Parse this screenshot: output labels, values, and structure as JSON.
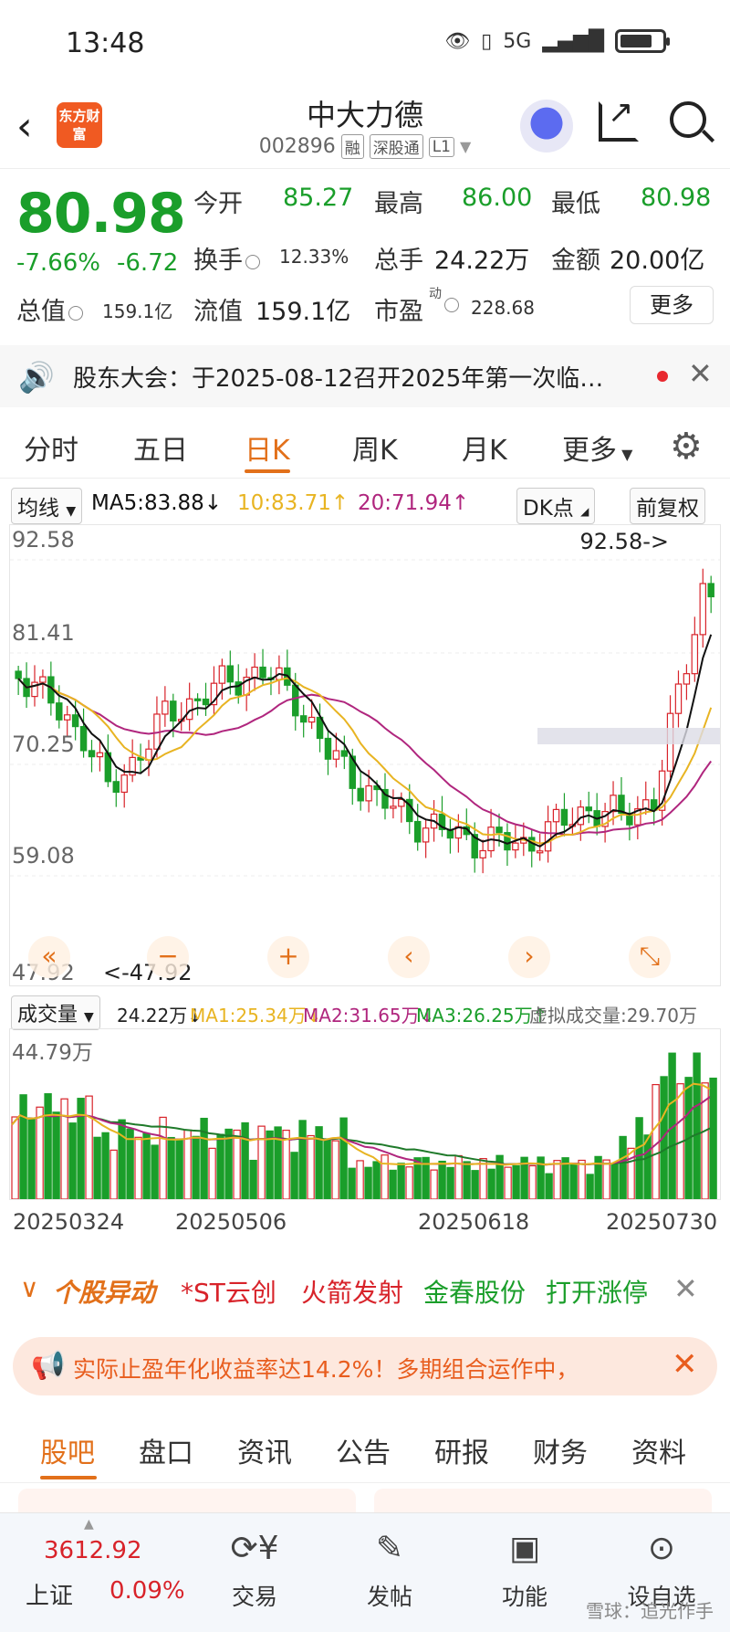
{
  "status_bar": {
    "time": "13:48",
    "network": "5G"
  },
  "header": {
    "title": "中大力德",
    "code": "002896",
    "tags": [
      "融",
      "深股通",
      "L1"
    ],
    "logo_text": "东方财富"
  },
  "quote": {
    "price": "80.98",
    "change_pct": "-7.66%",
    "change_abs": "-6.72",
    "open_label": "今开",
    "open": "85.27",
    "high_label": "最高",
    "high": "86.00",
    "low_label": "最低",
    "low": "80.98",
    "turnover_label": "换手",
    "turnover": "12.33%",
    "volume_label": "总手",
    "volume": "24.22万",
    "amount_label": "金额",
    "amount": "20.00亿",
    "mktcap_label": "总值",
    "mktcap": "159.1亿",
    "float_label": "流值",
    "float": "159.1亿",
    "pe_label": "市盈",
    "pe_sup": "动",
    "pe": "228.68",
    "more_label": "更多"
  },
  "notice": {
    "text": "股东大会：于2025-08-12召开2025年第一次临…"
  },
  "chart_tabs": [
    "分时",
    "五日",
    "日K",
    "周K",
    "月K",
    "更多"
  ],
  "ma_bar": {
    "selector": "均线",
    "ma5": "MA5:83.88",
    "ma10": "10:83.71",
    "ma20": "20:71.94",
    "dk": "DK点",
    "adjust": "前复权"
  },
  "kline": {
    "y_labels": [
      "92.58",
      "81.41",
      "70.25",
      "59.08",
      "47.92"
    ],
    "high_annotation": "92.58->",
    "low_annotation": "<-47.92",
    "nav_buttons": [
      "«",
      "−",
      "+",
      "‹",
      "›",
      "⤡"
    ]
  },
  "volume_bar": {
    "selector": "成交量",
    "vol": "24.22万",
    "ma1": "MA1:25.34万",
    "ma2": "MA2:31.65万",
    "ma3": "MA3:26.25万",
    "virtual": "虚拟成交量:29.70万",
    "max_label": "44.79万"
  },
  "dates": [
    "20250324",
    "20250506",
    "20250618",
    "20250730"
  ],
  "movers": {
    "title": "个股异动",
    "items": [
      "*ST云创",
      "火箭发射",
      "金春股份",
      "打开涨停"
    ]
  },
  "promo": {
    "text": "实际止盈年化收益率达14.2%！多期组合运作中，"
  },
  "bottom_tabs": [
    "股吧",
    "盘口",
    "资讯",
    "公告",
    "研报",
    "财务",
    "资料"
  ],
  "bottom_bar": {
    "index_value": "3612.92",
    "index_name": "上证",
    "index_pct": "0.09%",
    "items": [
      "交易",
      "发帖",
      "功能",
      "设自选"
    ]
  },
  "watermark": "雪球：追光作手",
  "colors": {
    "up": "#d8232a",
    "down": "#1a9e2a",
    "accent": "#e2701a",
    "ma5": "#111111",
    "ma10": "#e8b422",
    "ma20": "#b0267e"
  }
}
